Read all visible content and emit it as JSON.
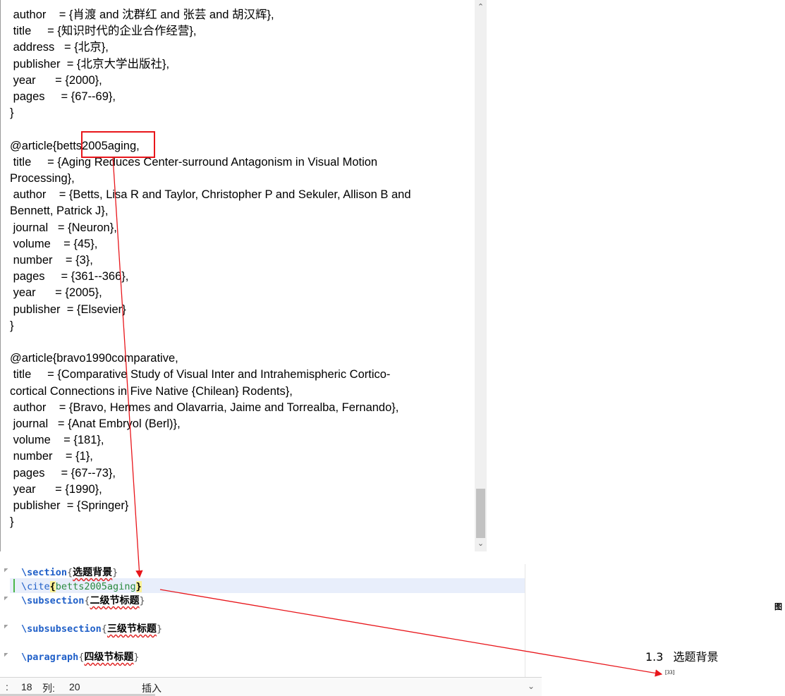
{
  "bib_editor": {
    "lines": [
      " author    = {肖渡 and 沈群红 and 张芸 and 胡汉辉},",
      " title     = {知识时代的企业合作经营},",
      " address   = {北京},",
      " publisher  = {北京大学出版社},",
      " year      = {2000},",
      " pages     = {67--69},",
      "}",
      "",
      "@article{betts2005aging,",
      " title     = {Aging Reduces Center-surround Antagonism in Visual Motion",
      "Processing},",
      " author    = {Betts, Lisa R and Taylor, Christopher P and Sekuler, Allison B and",
      "Bennett, Patrick J},",
      " journal   = {Neuron},",
      " volume    = {45},",
      " number    = {3},",
      " pages     = {361--366},",
      " year      = {2005},",
      " publisher  = {Elsevier}",
      "}",
      "",
      "@article{bravo1990comparative,",
      " title     = {Comparative Study of Visual Inter and Intrahemispheric Cortico-",
      "cortical Connections in Five Native {Chilean} Rodents},",
      " author    = {Bravo, Hermes and Olavarria, Jaime and Torrealba, Fernando},",
      " journal   = {Anat Embryol (Berl)},",
      " volume    = {181},",
      " number    = {1},",
      " pages     = {67--73},",
      " year      = {1990},",
      " publisher  = {Springer}",
      "}"
    ],
    "scroll_up_icon": "chevron-up-icon",
    "scroll_down_icon": "chevron-down-icon",
    "highlight_color": "#e8161b"
  },
  "tex_editor": {
    "lines": [
      {
        "cmd": "\\section",
        "arg": "选题背景",
        "kind": "zh"
      },
      {
        "cmd": "\\cite",
        "arg": "betts2005aging",
        "kind": "key"
      },
      {
        "cmd": "\\subsection",
        "arg": "二级节标题",
        "kind": "zh"
      },
      {
        "cmd": "",
        "arg": "",
        "kind": "blank"
      },
      {
        "cmd": "\\subsubsection",
        "arg": "三级节标题",
        "kind": "zh"
      },
      {
        "cmd": "",
        "arg": "",
        "kind": "blank"
      },
      {
        "cmd": "\\paragraph",
        "arg": "四级节标题",
        "kind": "zh"
      }
    ],
    "status": {
      "line_label": "18",
      "col_label": "列:",
      "col_value": "20",
      "mode": "插入"
    },
    "colors": {
      "command": "#1f5fc8",
      "cite_key": "#2a8a3e",
      "current_line": "#e8eefb"
    }
  },
  "preview": {
    "fig_tag": "图",
    "heading_number": "1.3",
    "heading_text": "选题背景",
    "citation": "[33]"
  },
  "annotation_color": "#e8161b"
}
